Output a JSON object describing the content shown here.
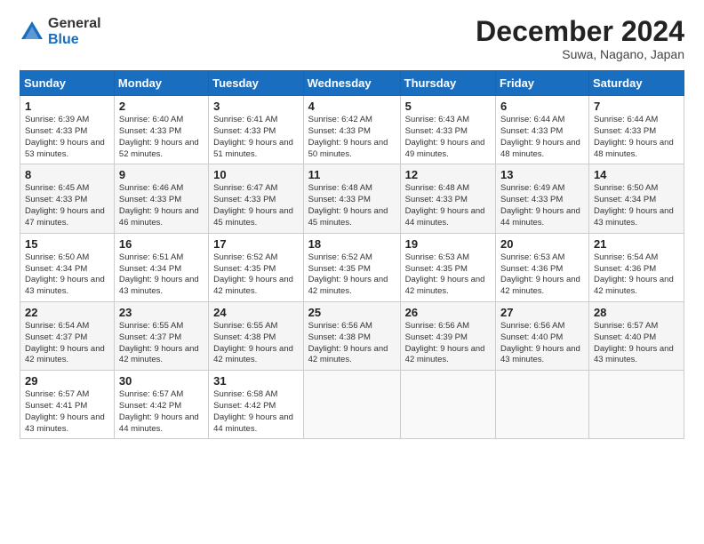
{
  "logo": {
    "general": "General",
    "blue": "Blue"
  },
  "header": {
    "title": "December 2024",
    "location": "Suwa, Nagano, Japan"
  },
  "weekdays": [
    "Sunday",
    "Monday",
    "Tuesday",
    "Wednesday",
    "Thursday",
    "Friday",
    "Saturday"
  ],
  "weeks": [
    [
      {
        "day": "1",
        "sunrise": "Sunrise: 6:39 AM",
        "sunset": "Sunset: 4:33 PM",
        "daylight": "Daylight: 9 hours and 53 minutes."
      },
      {
        "day": "2",
        "sunrise": "Sunrise: 6:40 AM",
        "sunset": "Sunset: 4:33 PM",
        "daylight": "Daylight: 9 hours and 52 minutes."
      },
      {
        "day": "3",
        "sunrise": "Sunrise: 6:41 AM",
        "sunset": "Sunset: 4:33 PM",
        "daylight": "Daylight: 9 hours and 51 minutes."
      },
      {
        "day": "4",
        "sunrise": "Sunrise: 6:42 AM",
        "sunset": "Sunset: 4:33 PM",
        "daylight": "Daylight: 9 hours and 50 minutes."
      },
      {
        "day": "5",
        "sunrise": "Sunrise: 6:43 AM",
        "sunset": "Sunset: 4:33 PM",
        "daylight": "Daylight: 9 hours and 49 minutes."
      },
      {
        "day": "6",
        "sunrise": "Sunrise: 6:44 AM",
        "sunset": "Sunset: 4:33 PM",
        "daylight": "Daylight: 9 hours and 48 minutes."
      },
      {
        "day": "7",
        "sunrise": "Sunrise: 6:44 AM",
        "sunset": "Sunset: 4:33 PM",
        "daylight": "Daylight: 9 hours and 48 minutes."
      }
    ],
    [
      {
        "day": "8",
        "sunrise": "Sunrise: 6:45 AM",
        "sunset": "Sunset: 4:33 PM",
        "daylight": "Daylight: 9 hours and 47 minutes."
      },
      {
        "day": "9",
        "sunrise": "Sunrise: 6:46 AM",
        "sunset": "Sunset: 4:33 PM",
        "daylight": "Daylight: 9 hours and 46 minutes."
      },
      {
        "day": "10",
        "sunrise": "Sunrise: 6:47 AM",
        "sunset": "Sunset: 4:33 PM",
        "daylight": "Daylight: 9 hours and 45 minutes."
      },
      {
        "day": "11",
        "sunrise": "Sunrise: 6:48 AM",
        "sunset": "Sunset: 4:33 PM",
        "daylight": "Daylight: 9 hours and 45 minutes."
      },
      {
        "day": "12",
        "sunrise": "Sunrise: 6:48 AM",
        "sunset": "Sunset: 4:33 PM",
        "daylight": "Daylight: 9 hours and 44 minutes."
      },
      {
        "day": "13",
        "sunrise": "Sunrise: 6:49 AM",
        "sunset": "Sunset: 4:33 PM",
        "daylight": "Daylight: 9 hours and 44 minutes."
      },
      {
        "day": "14",
        "sunrise": "Sunrise: 6:50 AM",
        "sunset": "Sunset: 4:34 PM",
        "daylight": "Daylight: 9 hours and 43 minutes."
      }
    ],
    [
      {
        "day": "15",
        "sunrise": "Sunrise: 6:50 AM",
        "sunset": "Sunset: 4:34 PM",
        "daylight": "Daylight: 9 hours and 43 minutes."
      },
      {
        "day": "16",
        "sunrise": "Sunrise: 6:51 AM",
        "sunset": "Sunset: 4:34 PM",
        "daylight": "Daylight: 9 hours and 43 minutes."
      },
      {
        "day": "17",
        "sunrise": "Sunrise: 6:52 AM",
        "sunset": "Sunset: 4:35 PM",
        "daylight": "Daylight: 9 hours and 42 minutes."
      },
      {
        "day": "18",
        "sunrise": "Sunrise: 6:52 AM",
        "sunset": "Sunset: 4:35 PM",
        "daylight": "Daylight: 9 hours and 42 minutes."
      },
      {
        "day": "19",
        "sunrise": "Sunrise: 6:53 AM",
        "sunset": "Sunset: 4:35 PM",
        "daylight": "Daylight: 9 hours and 42 minutes."
      },
      {
        "day": "20",
        "sunrise": "Sunrise: 6:53 AM",
        "sunset": "Sunset: 4:36 PM",
        "daylight": "Daylight: 9 hours and 42 minutes."
      },
      {
        "day": "21",
        "sunrise": "Sunrise: 6:54 AM",
        "sunset": "Sunset: 4:36 PM",
        "daylight": "Daylight: 9 hours and 42 minutes."
      }
    ],
    [
      {
        "day": "22",
        "sunrise": "Sunrise: 6:54 AM",
        "sunset": "Sunset: 4:37 PM",
        "daylight": "Daylight: 9 hours and 42 minutes."
      },
      {
        "day": "23",
        "sunrise": "Sunrise: 6:55 AM",
        "sunset": "Sunset: 4:37 PM",
        "daylight": "Daylight: 9 hours and 42 minutes."
      },
      {
        "day": "24",
        "sunrise": "Sunrise: 6:55 AM",
        "sunset": "Sunset: 4:38 PM",
        "daylight": "Daylight: 9 hours and 42 minutes."
      },
      {
        "day": "25",
        "sunrise": "Sunrise: 6:56 AM",
        "sunset": "Sunset: 4:38 PM",
        "daylight": "Daylight: 9 hours and 42 minutes."
      },
      {
        "day": "26",
        "sunrise": "Sunrise: 6:56 AM",
        "sunset": "Sunset: 4:39 PM",
        "daylight": "Daylight: 9 hours and 42 minutes."
      },
      {
        "day": "27",
        "sunrise": "Sunrise: 6:56 AM",
        "sunset": "Sunset: 4:40 PM",
        "daylight": "Daylight: 9 hours and 43 minutes."
      },
      {
        "day": "28",
        "sunrise": "Sunrise: 6:57 AM",
        "sunset": "Sunset: 4:40 PM",
        "daylight": "Daylight: 9 hours and 43 minutes."
      }
    ],
    [
      {
        "day": "29",
        "sunrise": "Sunrise: 6:57 AM",
        "sunset": "Sunset: 4:41 PM",
        "daylight": "Daylight: 9 hours and 43 minutes."
      },
      {
        "day": "30",
        "sunrise": "Sunrise: 6:57 AM",
        "sunset": "Sunset: 4:42 PM",
        "daylight": "Daylight: 9 hours and 44 minutes."
      },
      {
        "day": "31",
        "sunrise": "Sunrise: 6:58 AM",
        "sunset": "Sunset: 4:42 PM",
        "daylight": "Daylight: 9 hours and 44 minutes."
      },
      null,
      null,
      null,
      null
    ]
  ]
}
